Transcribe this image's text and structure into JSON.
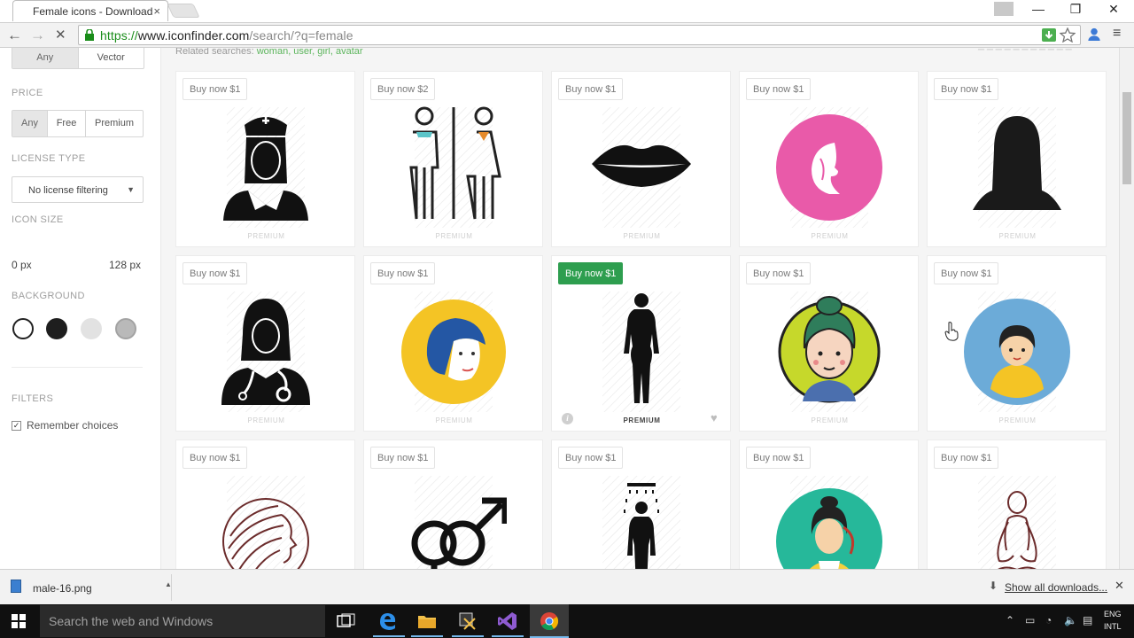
{
  "browser": {
    "tab_title": "Female icons - Download",
    "tab_close": "×",
    "url_scheme": "https://",
    "url_host": "www.iconfinder.com",
    "url_path": "/search/?q=female",
    "win_min": "—",
    "win_restore": "❐",
    "win_close": "✕",
    "nav_back": "←",
    "nav_forward": "→",
    "nav_stop": "✕",
    "menu_glyph": "≡"
  },
  "sidebar": {
    "type_options": [
      "Any",
      "Vector"
    ],
    "price_label": "PRICE",
    "price_options": [
      "Any",
      "Free",
      "Premium"
    ],
    "license_label": "LICENSE TYPE",
    "license_value": "No license filtering",
    "icon_size_label": "ICON SIZE",
    "size_min": "0 px",
    "size_max": "128 px",
    "background_label": "BACKGROUND",
    "background_swatches": [
      "#ffffff",
      "#1e1e1e",
      "#e2e2e2",
      "#b9b9b9"
    ],
    "filters_label": "FILTERS",
    "remember_label": "Remember choices",
    "remember_checked": true
  },
  "content": {
    "related_prefix": "Related searches:",
    "related_links": "woman, user, girl, avatar",
    "cards": [
      {
        "buy": "Buy now $1",
        "premium": "PREMIUM",
        "icon": "nurse-icon"
      },
      {
        "buy": "Buy now $2",
        "premium": "PREMIUM",
        "icon": "restroom-icon"
      },
      {
        "buy": "Buy now $1",
        "premium": "PREMIUM",
        "icon": "lips-icon"
      },
      {
        "buy": "Buy now $1",
        "premium": "PREMIUM",
        "icon": "woman-profile-circle-icon"
      },
      {
        "buy": "Buy now $1",
        "premium": "PREMIUM",
        "icon": "woman-silhouette-icon"
      },
      {
        "buy": "Buy now $1",
        "premium": "PREMIUM",
        "icon": "female-doctor-icon"
      },
      {
        "buy": "Buy now $1",
        "premium": "PREMIUM",
        "icon": "woman-avatar-yellow-icon"
      },
      {
        "buy": "Buy now $1",
        "premium": "PREMIUM",
        "icon": "female-body-icon",
        "hovered": true
      },
      {
        "buy": "Buy now $1",
        "premium": "PREMIUM",
        "icon": "woman-avatar-green-icon"
      },
      {
        "buy": "Buy now $1",
        "premium": "PREMIUM",
        "icon": "woman-avatar-blue-icon"
      },
      {
        "buy": "Buy now $1",
        "premium": "",
        "icon": "woman-hair-line-icon"
      },
      {
        "buy": "Buy now $1",
        "premium": "",
        "icon": "gender-symbol-icon"
      },
      {
        "buy": "Buy now $1",
        "premium": "",
        "icon": "shower-woman-icon"
      },
      {
        "buy": "Buy now $1",
        "premium": "",
        "icon": "woman-avatar-teal-icon"
      },
      {
        "buy": "Buy now $1",
        "premium": "",
        "icon": "yoga-pose-icon"
      }
    ]
  },
  "downloads": {
    "file_name": "male-16.png",
    "show_all": "Show all downloads..."
  },
  "taskbar": {
    "search_placeholder": "Search the web and Windows",
    "lang_line1": "ENG",
    "lang_line2": "INTL"
  },
  "colors": {
    "accent_green": "#2e9e4f",
    "link_green": "#5db55d",
    "url_green": "#1a8d1a"
  }
}
